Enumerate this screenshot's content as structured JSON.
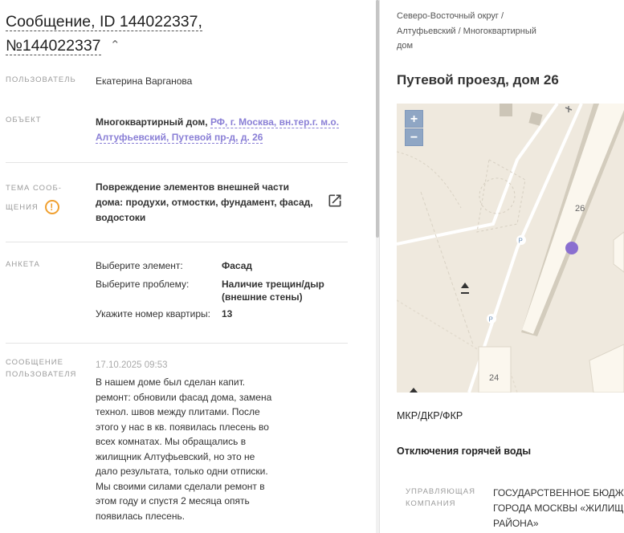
{
  "header": {
    "title_line1": "Сообщение, ID 144022337,",
    "title_line2": "№144022337",
    "collapse_glyph": "⌃"
  },
  "fields": {
    "user_label": "ПОЛЬЗОВАТЕЛЬ",
    "user_value": "Екатерина Варганова",
    "object_label": "ОБЪЕКТ",
    "object_prefix": "Многоквартирный дом, ",
    "object_link_line1": "РФ, г. Москва, вн.тер.г. м.о.",
    "object_link_line2": "Алтуфьевский, Путевой пр-д, д. 26",
    "topic_label_line1": "ТЕМА СООБ-",
    "topic_label_line2": "ЩЕНИЯ",
    "topic_warning_glyph": "!",
    "topic_value_line1": "Повреждение элементов внешней части",
    "topic_value_line2": "дома: продухи, отмостки, фундамент, фасад,",
    "topic_value_line3": "водостоки",
    "form_label": "АНКЕТА",
    "form": [
      {
        "question": "Выберите элемент:",
        "answer": "Фасад"
      },
      {
        "question": "Выберите проблему:",
        "answer_line1": "Наличие трещин/дыр",
        "answer_line2": "(внешние стены)"
      },
      {
        "question": "Укажите номер квартиры:",
        "answer": "13"
      }
    ],
    "message_label_line1": "СООБЩЕНИЕ",
    "message_label_line2": "ПОЛЬЗОВАТЕЛЯ",
    "message_date": "17.10.2025 09:53",
    "message_lines": [
      "В нашем доме был сделан капит.",
      "ремонт: обновили фасад дома, замена",
      "технол. швов между плитами. После",
      "этого у нас в кв. появилась плесень во",
      "всех комнатах. Мы обращались в",
      "жилищник Алтуфьевский, но это не",
      "дало результата, только одни отписки.",
      "Мы своими силами сделали ремонт в",
      "этом году и спустя 2 месяца опять",
      "появилась плесень."
    ]
  },
  "right": {
    "breadcrumb_line1": "Северо-Восточный округ /",
    "breadcrumb_line2": "Алтуфьевский / Многоквартирный",
    "breadcrumb_line3": "дом",
    "address_title": "Путевой проезд, дом 26",
    "map": {
      "zoom_in": "+",
      "zoom_out": "−",
      "building_26": "26",
      "building_24": "24",
      "parking_1": "P",
      "parking_2": "P",
      "marker_color": "#8a6fd0"
    },
    "mkr_label": "МКР/ДКР/ФКР",
    "hot_water_label": "Отключения горячей воды",
    "company_label_line1": "УПРАВЛЯЮЩАЯ",
    "company_label_line2": "КОМПАНИЯ",
    "company_value_line1": "ГОСУДАРСТВЕННОЕ БЮДЖЕ",
    "company_value_line2": "ГОРОДА МОСКВЫ «ЖИЛИЩ",
    "company_value_line3": "РАЙОНА»"
  }
}
